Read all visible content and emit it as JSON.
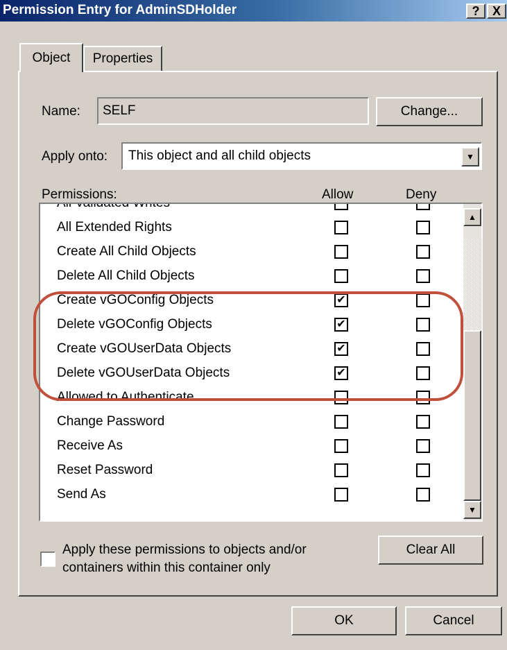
{
  "window": {
    "title": "Permission Entry for AdminSDHolder",
    "help_label": "?",
    "close_label": "X"
  },
  "tabs": [
    {
      "label": "Object",
      "selected": true
    },
    {
      "label": "Properties",
      "selected": false
    }
  ],
  "name_field": {
    "label": "Name:",
    "value": "SELF",
    "change_label": "Change..."
  },
  "apply_onto": {
    "label": "Apply onto:",
    "value": "This object and all child objects"
  },
  "permissions": {
    "label": "Permissions:",
    "allow_header": "Allow",
    "deny_header": "Deny",
    "rows": [
      {
        "label": "All Validated Writes",
        "allow": false,
        "deny": false
      },
      {
        "label": "All Extended Rights",
        "allow": false,
        "deny": false
      },
      {
        "label": "Create All Child Objects",
        "allow": false,
        "deny": false
      },
      {
        "label": "Delete All Child Objects",
        "allow": false,
        "deny": false
      },
      {
        "label": "Create vGOConfig Objects",
        "allow": true,
        "deny": false
      },
      {
        "label": "Delete vGOConfig Objects",
        "allow": true,
        "deny": false
      },
      {
        "label": "Create vGOUserData Objects",
        "allow": true,
        "deny": false
      },
      {
        "label": "Delete vGOUserData Objects",
        "allow": true,
        "deny": false
      },
      {
        "label": "Allowed to Authenticate",
        "allow": false,
        "deny": false
      },
      {
        "label": "Change Password",
        "allow": false,
        "deny": false
      },
      {
        "label": "Receive As",
        "allow": false,
        "deny": false
      },
      {
        "label": "Reset Password",
        "allow": false,
        "deny": false
      },
      {
        "label": "Send As",
        "allow": false,
        "deny": false
      }
    ]
  },
  "apply_these": {
    "line1": "Apply these permissions to objects and/or",
    "line2": "containers within this container only",
    "checked": false
  },
  "clear_all_label": "Clear All",
  "ok_label": "OK",
  "cancel_label": "Cancel",
  "colors": {
    "highlight_ring": "#c0503c",
    "title_bar": "#0a246a"
  }
}
